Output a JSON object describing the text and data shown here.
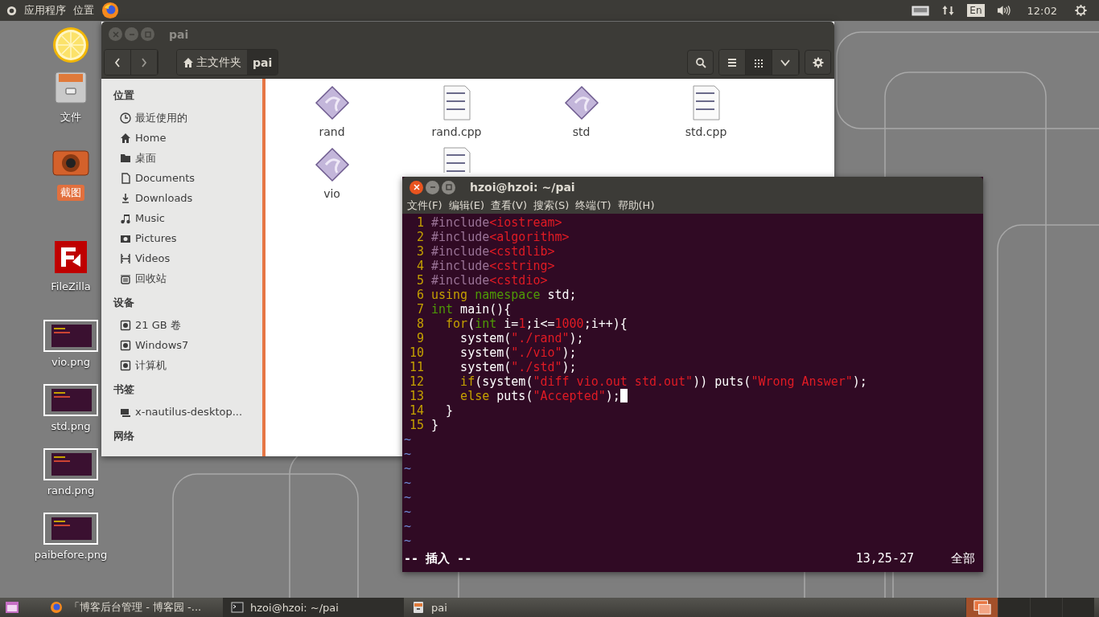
{
  "top_panel": {
    "menus": [
      "应用程序",
      "位置"
    ],
    "keyboard_layout": "En",
    "clock": "12:02"
  },
  "desktop_icons": [
    {
      "kind": "lemon",
      "selected": false
    },
    {
      "kind": "drawer",
      "label": "文件",
      "selected": false
    },
    {
      "kind": "camera",
      "label": "截图",
      "selected": true
    },
    {
      "kind": "filezilla",
      "label": "FileZilla",
      "selected": false
    },
    {
      "label": "vio.png",
      "selected": false
    },
    {
      "label": "std.png",
      "selected": false
    },
    {
      "label": "rand.png",
      "selected": false
    },
    {
      "label": "paibefore.png",
      "selected": false
    }
  ],
  "file_manager": {
    "title": "pai",
    "active": false,
    "breadcrumbs": [
      {
        "kind": "home",
        "label": "主文件夹",
        "selected": false
      },
      {
        "kind": "folder",
        "label": "pai",
        "selected": true
      }
    ],
    "view_buttons": [
      {
        "kind": "list",
        "selected": false
      },
      {
        "kind": "grid",
        "selected": true
      }
    ],
    "sidebar": [
      {
        "heading": "位置",
        "items": [
          {
            "kind": "recent",
            "label": "最近使用的"
          },
          {
            "kind": "home",
            "label": "Home"
          },
          {
            "kind": "folder",
            "label": "桌面"
          },
          {
            "kind": "document",
            "label": "Documents"
          },
          {
            "kind": "download",
            "label": "Downloads"
          },
          {
            "kind": "music",
            "label": "Music"
          },
          {
            "kind": "pictures",
            "label": "Pictures"
          },
          {
            "kind": "videos",
            "label": "Videos"
          },
          {
            "kind": "trash",
            "label": "回收站"
          }
        ]
      },
      {
        "heading": "设备",
        "items": [
          {
            "kind": "drive",
            "label": "21 GB 卷"
          },
          {
            "kind": "drive",
            "label": "Windows7"
          },
          {
            "kind": "drive",
            "label": "计算机"
          }
        ]
      },
      {
        "heading": "书签",
        "items": [
          {
            "kind": "bookmark",
            "label": "x-nautilus-desktop..."
          }
        ]
      },
      {
        "heading": "网络"
      }
    ],
    "files": [
      {
        "kind": "executable",
        "name": "rand"
      },
      {
        "kind": "source",
        "name": "rand.cpp"
      },
      {
        "kind": "executable",
        "name": "std"
      },
      {
        "kind": "source",
        "name": "std.cpp"
      },
      {
        "kind": "executable",
        "name": "vio"
      },
      {
        "kind": "source"
      }
    ]
  },
  "terminal": {
    "title": "hzoi@hzoi: ~/pai",
    "active": true,
    "menu": [
      "文件(F)",
      "编辑(E)",
      "查看(V)",
      "搜索(S)",
      "终端(T)",
      "帮助(H)"
    ],
    "lines": [
      {
        "number": "1",
        "cursor": false,
        "tokens": [
          {
            "kind": "pre",
            "text": "#include"
          },
          {
            "kind": "str",
            "text": "<iostream>"
          }
        ]
      },
      {
        "number": "2",
        "cursor": false,
        "tokens": [
          {
            "kind": "pre",
            "text": "#include"
          },
          {
            "kind": "str",
            "text": "<algorithm>"
          }
        ]
      },
      {
        "number": "3",
        "cursor": false,
        "tokens": [
          {
            "kind": "pre",
            "text": "#include"
          },
          {
            "kind": "str",
            "text": "<cstdlib>"
          }
        ]
      },
      {
        "number": "4",
        "cursor": false,
        "tokens": [
          {
            "kind": "pre",
            "text": "#include"
          },
          {
            "kind": "str",
            "text": "<cstring>"
          }
        ]
      },
      {
        "number": "5",
        "cursor": false,
        "tokens": [
          {
            "kind": "pre",
            "text": "#include"
          },
          {
            "kind": "str",
            "text": "<cstdio>"
          }
        ]
      },
      {
        "number": "6",
        "cursor": false,
        "tokens": [
          {
            "kind": "stmt",
            "text": "using"
          },
          {
            "kind": "type",
            "text": " namespace"
          },
          {
            "kind": "plain",
            "text": " std;"
          }
        ]
      },
      {
        "number": "7",
        "cursor": false,
        "tokens": [
          {
            "kind": "type",
            "text": "int"
          },
          {
            "kind": "plain",
            "text": " main(){"
          }
        ]
      },
      {
        "number": "8",
        "cursor": false,
        "tokens": [
          {
            "kind": "stmt",
            "text": "  for"
          },
          {
            "kind": "plain",
            "text": "("
          },
          {
            "kind": "type",
            "text": "int"
          },
          {
            "kind": "plain",
            "text": " i="
          },
          {
            "kind": "num",
            "text": "1"
          },
          {
            "kind": "plain",
            "text": ";i<="
          },
          {
            "kind": "num",
            "text": "1000"
          },
          {
            "kind": "plain",
            "text": ";i++){"
          }
        ]
      },
      {
        "number": "9",
        "cursor": false,
        "tokens": [
          {
            "kind": "plain",
            "text": "    system("
          },
          {
            "kind": "str",
            "text": "\"./rand\""
          },
          {
            "kind": "plain",
            "text": ");"
          }
        ]
      },
      {
        "number": "10",
        "cursor": false,
        "tokens": [
          {
            "kind": "plain",
            "text": "    system("
          },
          {
            "kind": "str",
            "text": "\"./vio\""
          },
          {
            "kind": "plain",
            "text": ");"
          }
        ]
      },
      {
        "number": "11",
        "cursor": false,
        "tokens": [
          {
            "kind": "plain",
            "text": "    system("
          },
          {
            "kind": "str",
            "text": "\"./std\""
          },
          {
            "kind": "plain",
            "text": ");"
          }
        ]
      },
      {
        "number": "12",
        "cursor": false,
        "tokens": [
          {
            "kind": "stmt",
            "text": "    if"
          },
          {
            "kind": "plain",
            "text": "(system("
          },
          {
            "kind": "str",
            "text": "\"diff vio.out std.out\""
          },
          {
            "kind": "plain",
            "text": ")) puts("
          },
          {
            "kind": "str",
            "text": "\"Wrong Answer\""
          },
          {
            "kind": "plain",
            "text": ");"
          }
        ]
      },
      {
        "number": "13",
        "cursor": true,
        "tokens": [
          {
            "kind": "stmt",
            "text": "    else"
          },
          {
            "kind": "plain",
            "text": " puts("
          },
          {
            "kind": "str",
            "text": "\"Accepted\""
          },
          {
            "kind": "plain",
            "text": ");"
          }
        ]
      },
      {
        "number": "14",
        "cursor": false,
        "tokens": [
          {
            "kind": "plain",
            "text": "  }"
          }
        ]
      },
      {
        "number": "15",
        "cursor": false,
        "tokens": [
          {
            "kind": "plain",
            "text": "}"
          }
        ]
      }
    ],
    "empty_lines": [
      "~",
      "~",
      "~",
      "~",
      "~",
      "~",
      "~",
      "~"
    ],
    "status": {
      "mode": "-- 插入 --",
      "position": "13,25-27",
      "scroll": "全部"
    }
  },
  "taskbar": {
    "items": [
      {
        "kind": "browser",
        "label": "「博客后台管理 - 博客园 -...",
        "selected": false
      },
      {
        "kind": "terminal",
        "label": "hzoi@hzoi: ~/pai",
        "selected": true
      },
      {
        "kind": "files",
        "label": "pai",
        "selected": false
      }
    ],
    "workspaces": [
      {
        "selected": true
      },
      {
        "selected": false
      },
      {
        "selected": false
      },
      {
        "selected": false
      }
    ]
  }
}
